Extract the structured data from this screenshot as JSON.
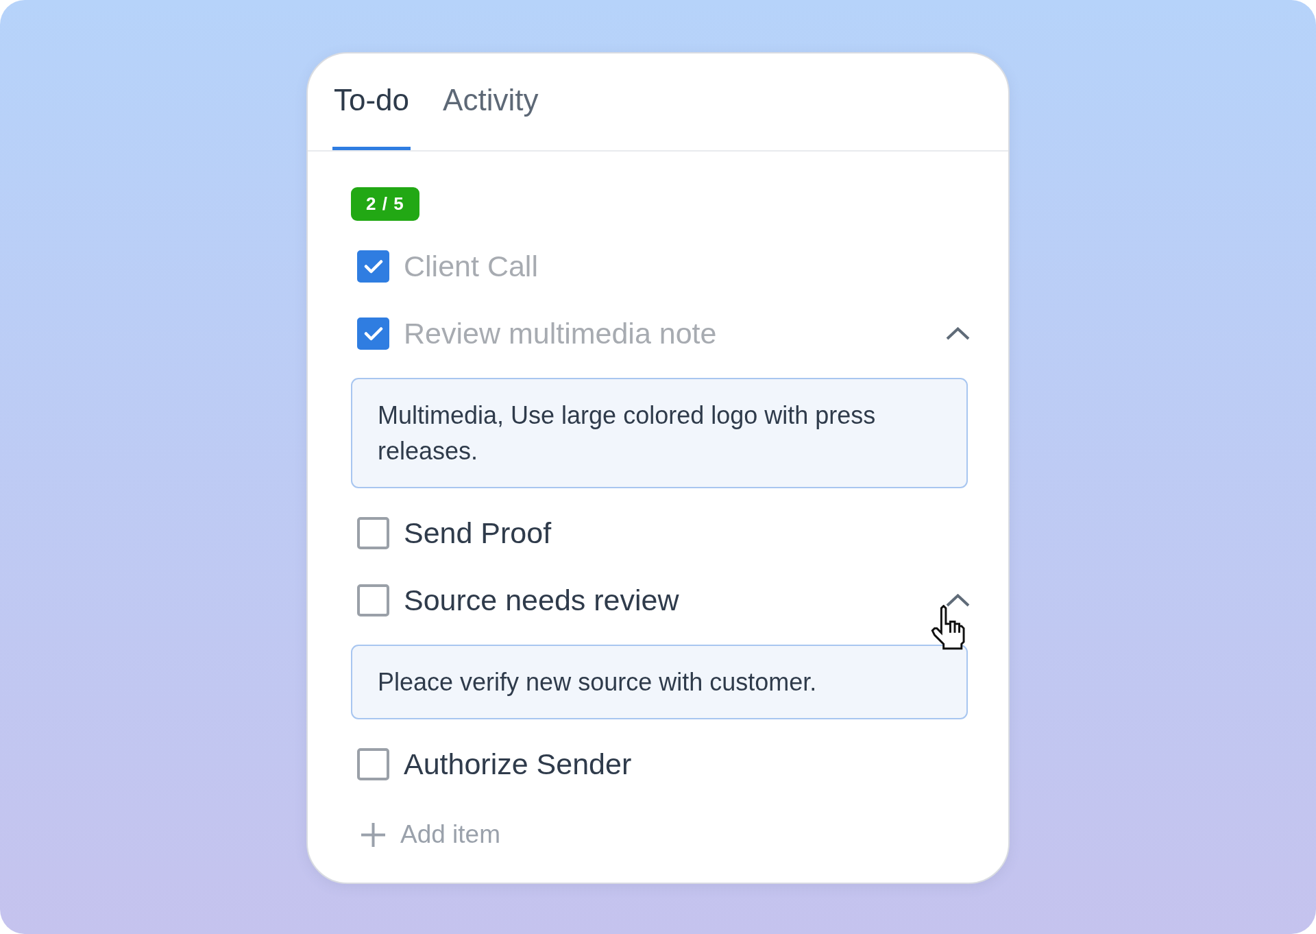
{
  "tabs": [
    {
      "label": "To-do",
      "selected": true
    },
    {
      "label": "Activity",
      "selected": false
    }
  ],
  "progress_badge": "2 / 5",
  "items": [
    {
      "label": "Client Call",
      "checked": true
    },
    {
      "label": "Review multimedia note",
      "checked": true,
      "note": {
        "text": "Multimedia, Use large colored logo with press releases.",
        "expanded": true,
        "hovered": false
      }
    },
    {
      "label": "Send Proof",
      "checked": false
    },
    {
      "label": "Source needs review",
      "checked": false,
      "note": {
        "text": "Pleace verify new source with customer.",
        "expanded": true,
        "hovered": true
      }
    },
    {
      "label": "Authorize Sender",
      "checked": false
    }
  ],
  "add_item": {
    "label": "Add item"
  }
}
